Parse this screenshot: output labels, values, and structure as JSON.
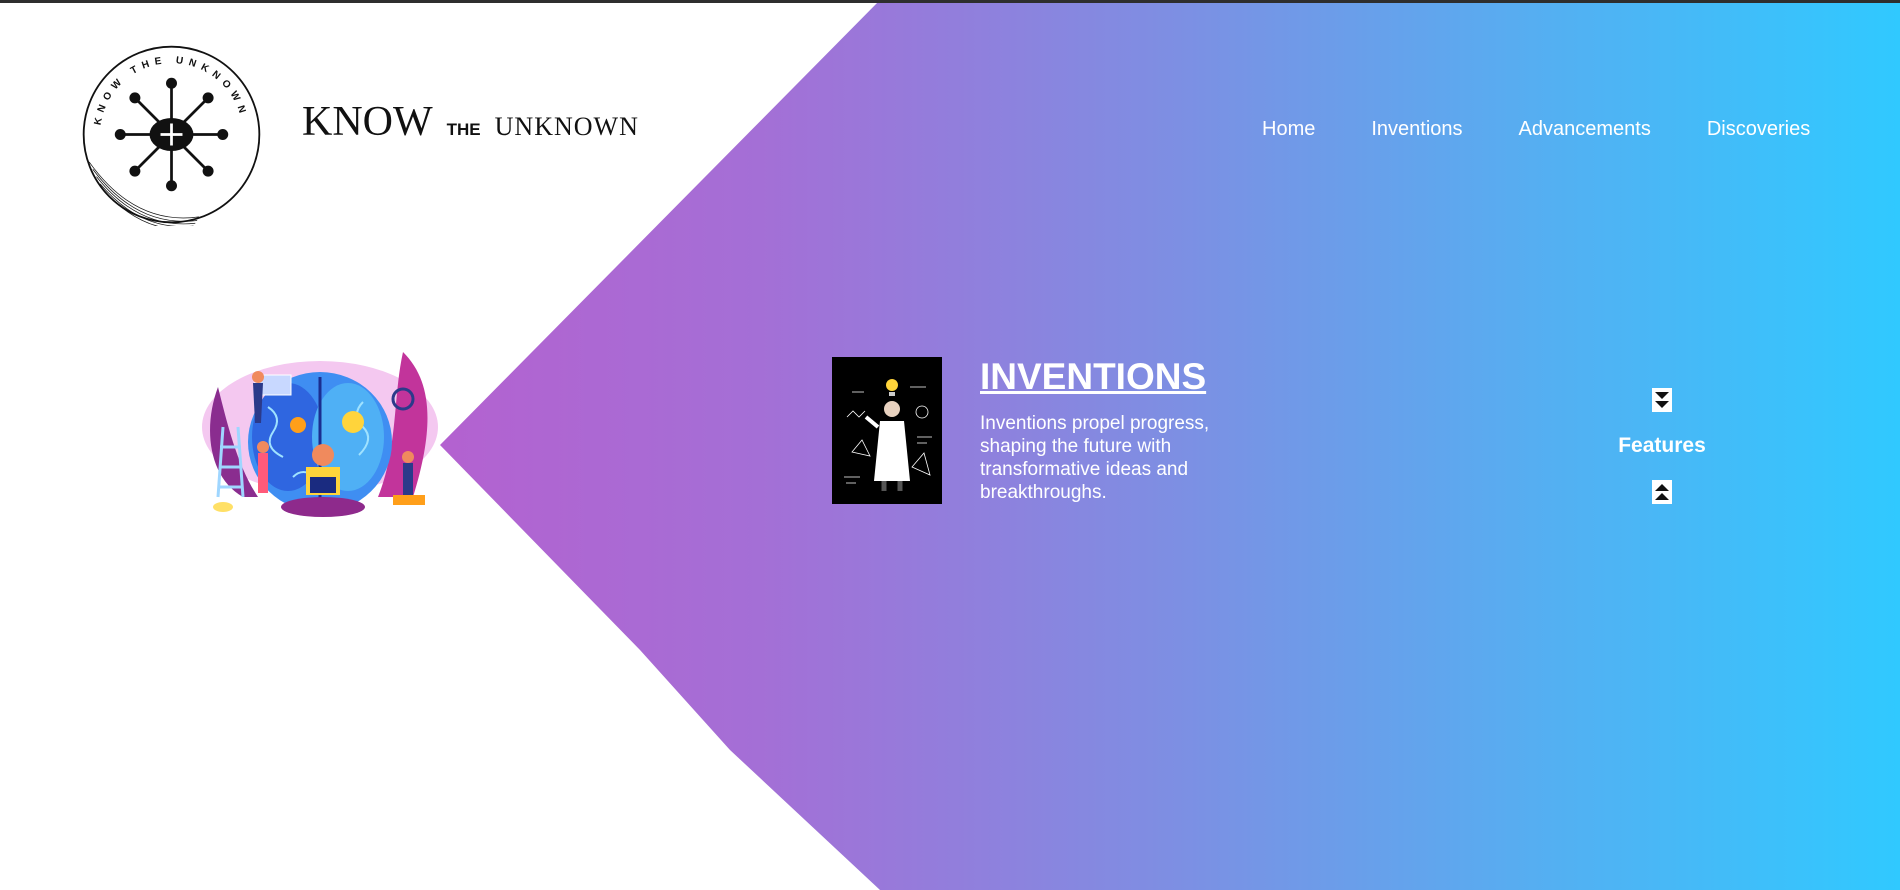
{
  "logo": {
    "ring_text": "KNOW THE UNKNOWN"
  },
  "brand": {
    "word1": "KNOW",
    "word2": "THE",
    "word3": "UNKNOWN"
  },
  "nav": {
    "items": [
      {
        "label": "Home"
      },
      {
        "label": "Inventions"
      },
      {
        "label": "Advancements"
      },
      {
        "label": "Discoveries"
      }
    ]
  },
  "card": {
    "title": "INVENTIONS",
    "description": "Inventions propel progress, shaping the future with transformative ideas and breakthroughs."
  },
  "features": {
    "label": "Features",
    "down_icon": "double-chevron-down-icon",
    "up_icon": "double-chevron-up-icon"
  },
  "colors": {
    "gradient_start": "#c94fc8",
    "gradient_end": "#30c9ff",
    "text_light": "#ffffff"
  }
}
